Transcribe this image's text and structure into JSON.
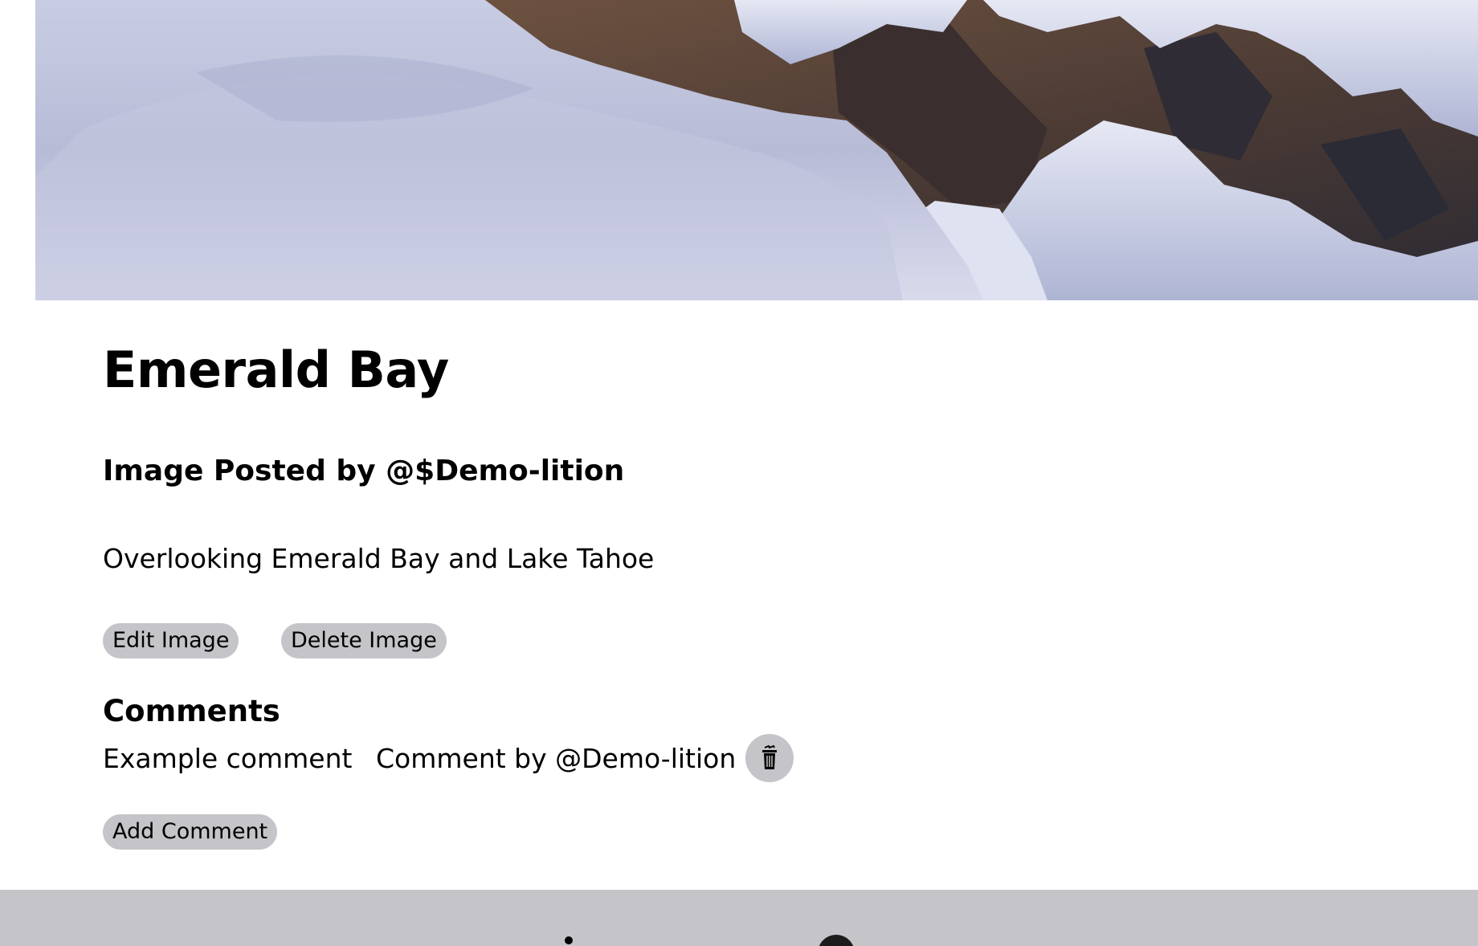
{
  "post": {
    "title": "Emerald Bay",
    "posted_by": "Image Posted by @$Demo-lition",
    "description": "Overlooking Emerald Bay and Lake Tahoe"
  },
  "actions": {
    "edit_label": "Edit Image",
    "delete_label": "Delete Image"
  },
  "comments": {
    "heading": "Comments",
    "items": [
      {
        "text": "Example comment",
        "author": "Comment by @Demo-lition"
      }
    ],
    "add_label": "Add Comment"
  },
  "icons": {
    "trash": "trash-icon",
    "footer_logo": "github-icon"
  },
  "colors": {
    "pill_bg": "#c5c4c9",
    "footer_bg": "#c5c4c9",
    "text": "#000000"
  }
}
